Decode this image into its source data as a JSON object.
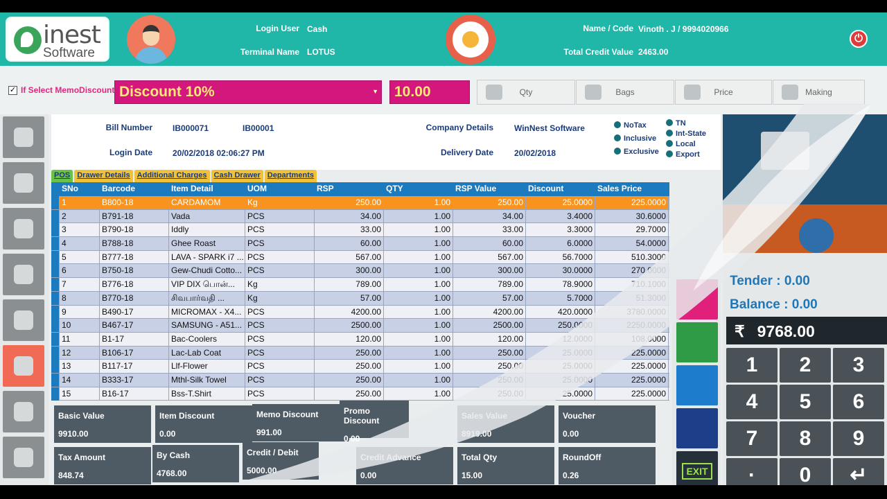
{
  "header": {
    "logo_brand": "inest",
    "logo_sub": "Software",
    "login_user_label": "Login User",
    "login_user_value": "Cash",
    "terminal_label": "Terminal Name",
    "terminal_value": "LOTUS",
    "name_code_label": "Name / Code",
    "name_code_value": "Vinoth . J / 9994020966",
    "total_credit_label": "Total Credit Value",
    "total_credit_value": "2463.00"
  },
  "memo": {
    "checkbox_label": "If Select MemoDiscount",
    "discount_selected": "Discount 10%",
    "discount_value": "10.00",
    "tabs": [
      "Qty",
      "Bags",
      "Price",
      "Making"
    ]
  },
  "bill": {
    "bill_number_label": "Bill Number",
    "bill_number_value1": "IB000071",
    "bill_number_value2": "IB00001",
    "login_date_label": "Login Date",
    "login_date_value": "20/02/2018 02:06:27 PM",
    "company_label": "Company Details",
    "company_value": "WinNest Software",
    "delivery_label": "Delivery Date",
    "delivery_value": "20/02/2018",
    "tax_options": [
      "NoTax",
      "Inclusive",
      "Exclusive"
    ],
    "region_options": [
      "TN",
      "Int-State",
      "Local",
      "Export"
    ]
  },
  "tabs": [
    "POS",
    "Drawer Details",
    "Additional Charges",
    "Cash Drawer",
    "Departments"
  ],
  "grid": {
    "columns": [
      "SNo",
      "Barcode",
      "Item Detail",
      "UOM",
      "RSP",
      "QTY",
      "RSP Value",
      "Discount",
      "Sales Price"
    ],
    "rows": [
      [
        "1",
        "B800-18",
        "CARDAMOM",
        "Kg",
        "250.00",
        "1.00",
        "250.00",
        "25.0000",
        "225.0000"
      ],
      [
        "2",
        "B791-18",
        "Vada",
        "PCS",
        "34.00",
        "1.00",
        "34.00",
        "3.4000",
        "30.6000"
      ],
      [
        "3",
        "B790-18",
        "Iddly",
        "PCS",
        "33.00",
        "1.00",
        "33.00",
        "3.3000",
        "29.7000"
      ],
      [
        "4",
        "B788-18",
        "Ghee Roast",
        "PCS",
        "60.00",
        "1.00",
        "60.00",
        "6.0000",
        "54.0000"
      ],
      [
        "5",
        "B777-18",
        "LAVA - SPARK i7 ...",
        "PCS",
        "567.00",
        "1.00",
        "567.00",
        "56.7000",
        "510.3000"
      ],
      [
        "6",
        "B750-18",
        "Gew-Chudi Cotto...",
        "PCS",
        "300.00",
        "1.00",
        "300.00",
        "30.0000",
        "270.0000"
      ],
      [
        "7",
        "B776-18",
        "VIP DIX பொன்...",
        "Kg",
        "789.00",
        "1.00",
        "789.00",
        "78.9000",
        "710.1000"
      ],
      [
        "8",
        "B770-18",
        "சிவபார்வதி ...",
        "Kg",
        "57.00",
        "1.00",
        "57.00",
        "5.7000",
        "51.3000"
      ],
      [
        "9",
        "B490-17",
        "MICROMAX - X4...",
        "PCS",
        "4200.00",
        "1.00",
        "4200.00",
        "420.0000",
        "3780.0000"
      ],
      [
        "10",
        "B467-17",
        "SAMSUNG - A51...",
        "PCS",
        "2500.00",
        "1.00",
        "2500.00",
        "250.0000",
        "2250.0000"
      ],
      [
        "11",
        "B1-17",
        "Bac-Coolers",
        "PCS",
        "120.00",
        "1.00",
        "120.00",
        "12.0000",
        "108.0000"
      ],
      [
        "12",
        "B106-17",
        "Lac-Lab Coat",
        "PCS",
        "250.00",
        "1.00",
        "250.00",
        "25.0000",
        "225.0000"
      ],
      [
        "13",
        "B117-17",
        "Llf-Flower",
        "PCS",
        "250.00",
        "1.00",
        "250.00",
        "25.0000",
        "225.0000"
      ],
      [
        "14",
        "B333-17",
        "Mthl-Silk Towel",
        "PCS",
        "250.00",
        "1.00",
        "250.00",
        "25.0000",
        "225.0000"
      ],
      [
        "15",
        "B16-17",
        "Bss-T.Shirt",
        "PCS",
        "250.00",
        "1.00",
        "250.00",
        "25.0000",
        "225.0000"
      ]
    ]
  },
  "summary": {
    "basic_value_label": "Basic Value",
    "basic_value": "9910.00",
    "item_discount_label": "Item Discount",
    "item_discount": "0.00",
    "memo_discount_label": "Memo Discount",
    "memo_discount": "991.00",
    "promo_discount_label": "Promo Discount",
    "promo_discount": "0.00",
    "sales_value_label": "Sales Value",
    "sales_value": "8919.00",
    "voucher_label": "Voucher",
    "voucher": "0.00",
    "tax_amount_label": "Tax Amount",
    "tax_amount": "848.74",
    "by_cash_label": "By Cash",
    "by_cash": "4768.00",
    "credit_debit_label": "Credit / Debit",
    "credit_debit": "5000.00",
    "credit_advance_label": "Credit Advance",
    "credit_advance": "0.00",
    "total_qty_label": "Total Qty",
    "total_qty": "15.00",
    "roundoff_label": "RoundOff",
    "roundoff": "0.26"
  },
  "payment": {
    "tender_label": "Tender",
    "tender": "0.00",
    "balance_label": "Balance",
    "balance": "0.00",
    "currency_symbol": "₹",
    "total": "9768.00"
  },
  "keypad": [
    "1",
    "2",
    "3",
    "4",
    "5",
    "6",
    "7",
    "8",
    "9",
    "·",
    "0",
    "↵"
  ],
  "exit_label": "EXIT",
  "colors": {
    "header": "#20b6a8",
    "discount": "#d3177d",
    "grid_header": "#1c7bbf",
    "selected_row": "#f7931e",
    "keypad": "#4a5257"
  }
}
